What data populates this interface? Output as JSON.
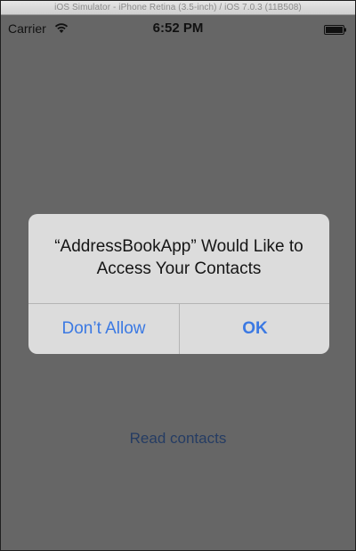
{
  "window": {
    "title": "iOS Simulator - iPhone Retina (3.5-inch) / iOS 7.0.3 (11B508)"
  },
  "status_bar": {
    "carrier": "Carrier",
    "time": "6:52 PM",
    "wifi_icon": "wifi-icon",
    "battery_icon": "battery-icon"
  },
  "main": {
    "read_contacts_label": "Read contacts"
  },
  "alert": {
    "title": "“AddressBookApp” Would Like to Access Your Contacts",
    "dont_allow_label": "Don’t Allow",
    "ok_label": "OK"
  },
  "colors": {
    "accent": "#3b79e3",
    "dimmed_background": "#666666",
    "alert_background": "#dcdcdc"
  }
}
